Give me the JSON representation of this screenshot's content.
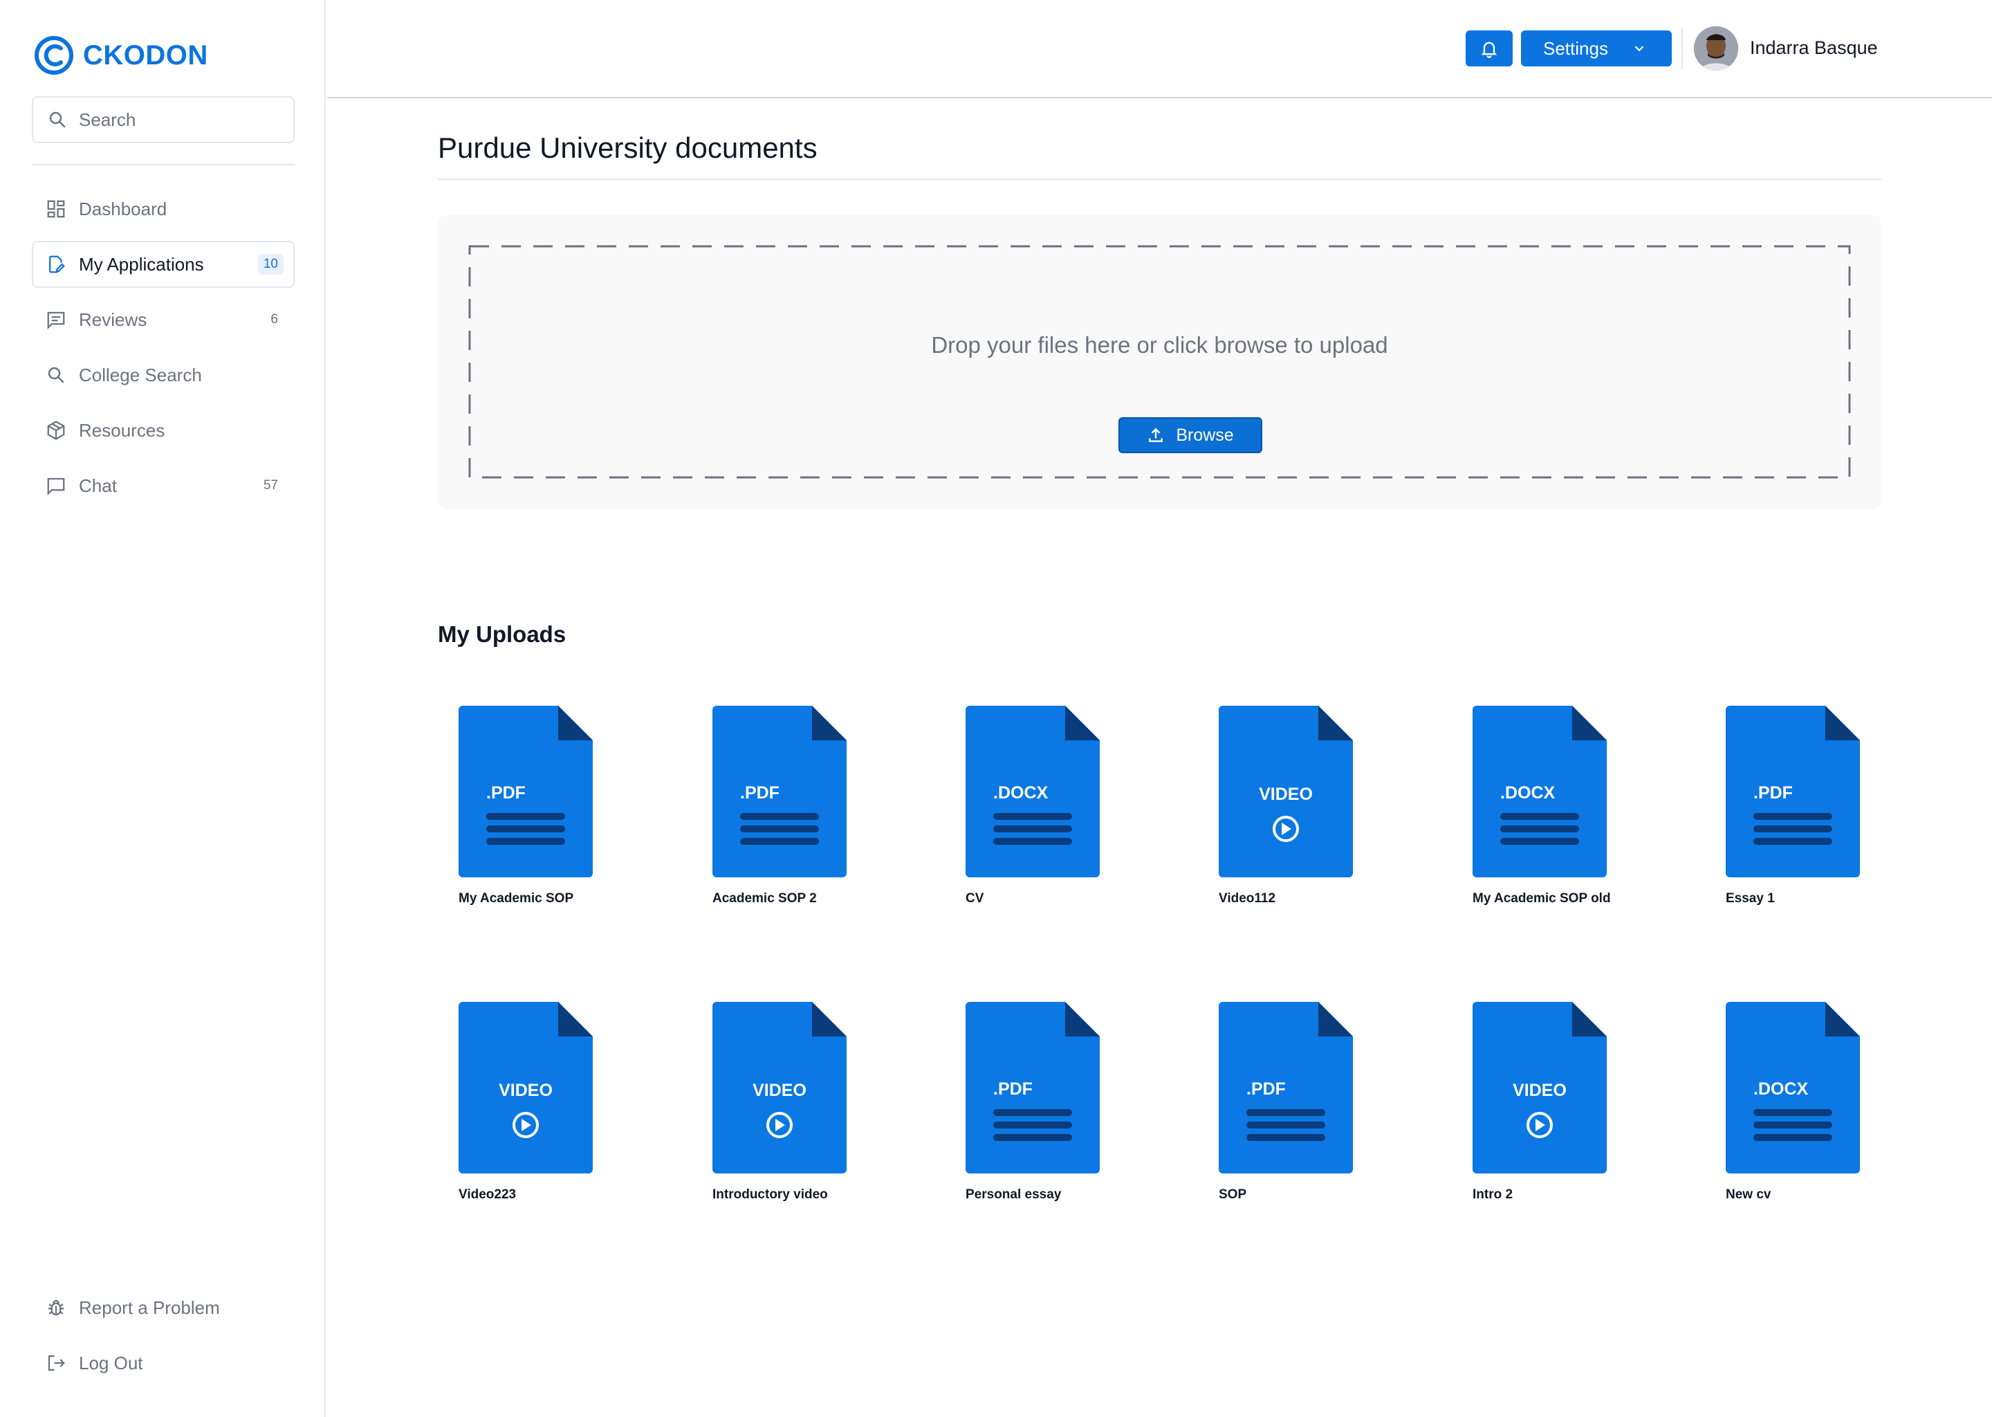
{
  "brand": {
    "name": "CKODON",
    "logo_icon": "ckodon-logo-icon",
    "color": "#0b74de"
  },
  "search": {
    "placeholder": "Search"
  },
  "sidebar": {
    "items": [
      {
        "label": "Dashboard",
        "icon": "dashboard-icon",
        "count": ""
      },
      {
        "label": "My Applications",
        "icon": "edit-document-icon",
        "count": "10",
        "active": true
      },
      {
        "label": "Reviews",
        "icon": "reviews-icon",
        "count": "6"
      },
      {
        "label": "College Search",
        "icon": "search-icon",
        "count": ""
      },
      {
        "label": "Resources",
        "icon": "package-icon",
        "count": ""
      },
      {
        "label": "Chat",
        "icon": "chat-icon",
        "count": "57"
      }
    ],
    "bottom_items": [
      {
        "label": "Report a Problem",
        "icon": "bug-icon"
      },
      {
        "label": "Log Out",
        "icon": "logout-icon"
      }
    ]
  },
  "header": {
    "notifications_icon": "bell-icon",
    "settings_label": "Settings",
    "user_name": "Indarra Basque"
  },
  "main": {
    "title": "Purdue University documents",
    "dropzone_text": "Drop your files here or click browse to upload",
    "browse_label": "Browse",
    "uploads_title": "My Uploads",
    "files": [
      {
        "type": ".PDF",
        "name": "My Academic SOP"
      },
      {
        "type": ".PDF",
        "name": "Academic SOP 2"
      },
      {
        "type": ".DOCX",
        "name": "CV"
      },
      {
        "type": "VIDEO",
        "name": "Video112"
      },
      {
        "type": ".DOCX",
        "name": "My Academic SOP old"
      },
      {
        "type": ".PDF",
        "name": "Essay 1"
      },
      {
        "type": "VIDEO",
        "name": "Video223"
      },
      {
        "type": "VIDEO",
        "name": "Introductory video"
      },
      {
        "type": ".PDF",
        "name": "Personal essay"
      },
      {
        "type": ".PDF",
        "name": "SOP"
      },
      {
        "type": "VIDEO",
        "name": "Intro 2"
      },
      {
        "type": ".DOCX",
        "name": "New cv"
      }
    ]
  },
  "colors": {
    "primary": "#0b74de",
    "file_blue": "#0b78e3",
    "file_fold": "#0a3b7a",
    "muted_text": "#6b7280"
  }
}
